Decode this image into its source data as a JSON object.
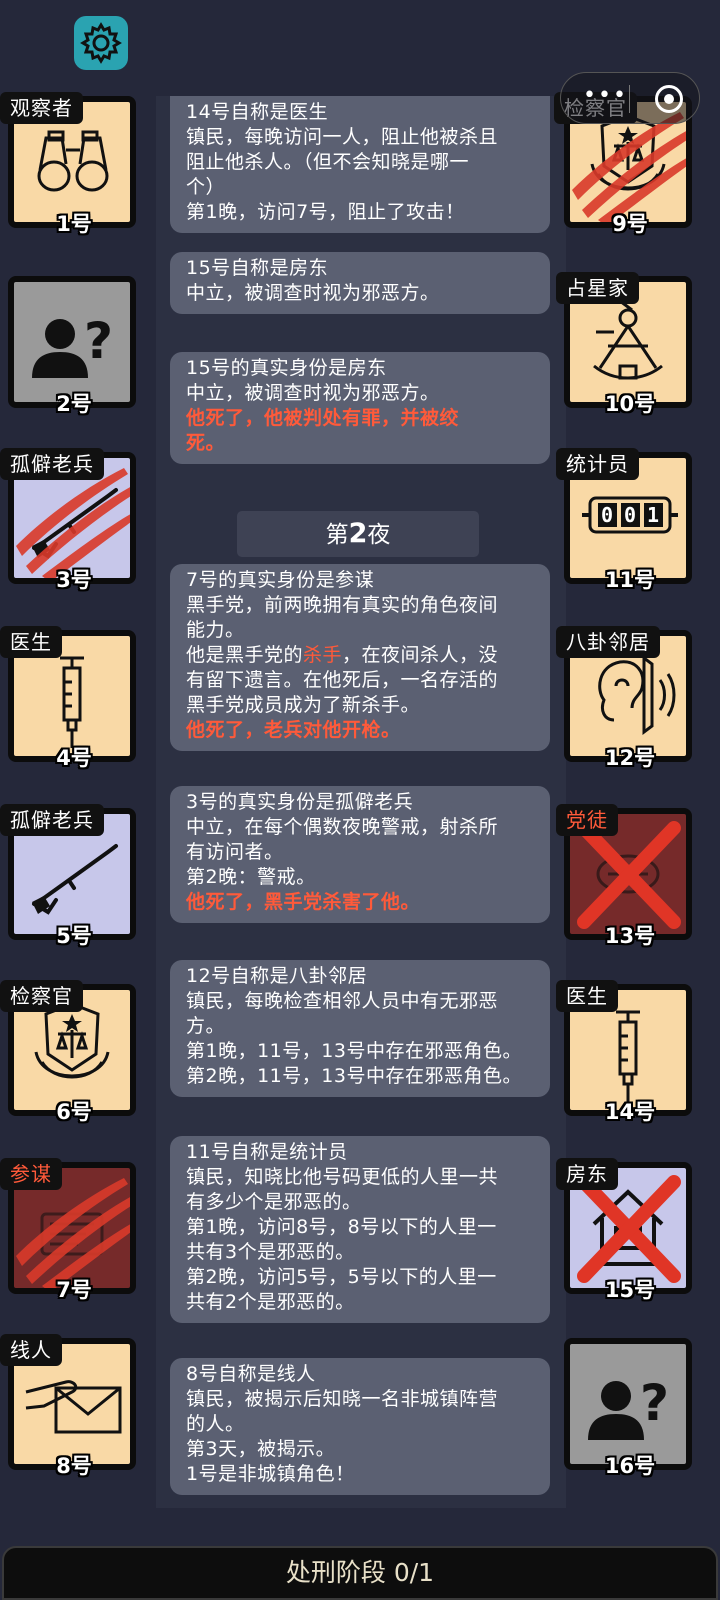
{
  "controls": {
    "settings_icon": "gear-icon",
    "menu_icon": "more-dots-icon",
    "close_icon": "target-icon",
    "menu_dots": "•••"
  },
  "players": [
    {
      "num": "1号",
      "role": "观察者",
      "icon": "binoculars-icon",
      "state": "alive"
    },
    {
      "num": "2号",
      "role": "",
      "icon": "unknown-person-icon",
      "state": "unknown"
    },
    {
      "num": "3号",
      "role": "孤僻老兵",
      "icon": "rifle-icon",
      "state": "clawed"
    },
    {
      "num": "4号",
      "role": "医生",
      "icon": "syringe-icon",
      "state": "alive"
    },
    {
      "num": "5号",
      "role": "孤僻老兵",
      "icon": "rifle-icon",
      "state": "alive"
    },
    {
      "num": "6号",
      "role": "检察官",
      "icon": "prosecutor-badge-icon",
      "state": "alive"
    },
    {
      "num": "7号",
      "role": "参谋",
      "icon": "planner-icon",
      "state": "clawed"
    },
    {
      "num": "8号",
      "role": "线人",
      "icon": "letter-hand-icon",
      "state": "alive"
    },
    {
      "num": "9号",
      "role": "检察官",
      "icon": "prosecutor-badge-icon",
      "state": "clawed"
    },
    {
      "num": "10号",
      "role": "占星家",
      "icon": "sextant-icon",
      "state": "alive"
    },
    {
      "num": "11号",
      "role": "统计员",
      "icon": "counter-icon",
      "state": "alive"
    },
    {
      "num": "12号",
      "role": "八卦邻居",
      "icon": "ear-icon",
      "state": "alive"
    },
    {
      "num": "13号",
      "role": "党徒",
      "icon": "cultist-icon",
      "state": "crossed"
    },
    {
      "num": "14号",
      "role": "医生",
      "icon": "syringe-icon",
      "state": "alive"
    },
    {
      "num": "15号",
      "role": "房东",
      "icon": "house-icon",
      "state": "crossed"
    },
    {
      "num": "16号",
      "role": "",
      "icon": "unknown-person-icon",
      "state": "unknown"
    }
  ],
  "counter_digits": "001",
  "log": {
    "night_banner_prefix": "第",
    "night_banner_num": "2",
    "night_banner_suffix": "夜",
    "messages": [
      {
        "lines": [
          {
            "t": "14号自称是医生"
          },
          {
            "t": "镇民，每晚访问一人，阻止他被杀且"
          },
          {
            "t": "阻止他杀人。（但不会知晓是哪一"
          },
          {
            "t": "个）"
          },
          {
            "t": "第1晚，访问7号，阻止了攻击！"
          }
        ]
      },
      {
        "lines": [
          {
            "t": "15号自称是房东"
          },
          {
            "t": "中立，被调查时视为邪恶方。"
          }
        ]
      },
      {
        "lines": [
          {
            "t": "15号的真实身份是房东"
          },
          {
            "t": "中立，被调查时视为邪恶方。"
          },
          {
            "t": "他死了，他被判处有罪，并被绞",
            "red": true
          },
          {
            "t": "死。",
            "red": true
          }
        ]
      },
      {
        "lines": [
          {
            "t": "7号的真实身份是参谋"
          },
          {
            "t": "黑手党，前两晚拥有真实的角色夜间"
          },
          {
            "t": "能力。"
          },
          {
            "t": "他是黑手党的",
            "hl": "杀手",
            "after": "，在夜间杀人，没"
          },
          {
            "t": "有留下遗言。在他死后，一名存活的"
          },
          {
            "t": "黑手党成员成为了新杀手。"
          },
          {
            "t": "他死了，老兵对他开枪。",
            "red": true
          }
        ]
      },
      {
        "lines": [
          {
            "t": "3号的真实身份是孤僻老兵"
          },
          {
            "t": "中立，在每个偶数夜晚警戒，射杀所"
          },
          {
            "t": "有访问者。"
          },
          {
            "t": "第2晚：警戒。"
          },
          {
            "t": "他死了，黑手党杀害了他。",
            "red": true
          }
        ]
      },
      {
        "lines": [
          {
            "t": "12号自称是八卦邻居"
          },
          {
            "t": "镇民，每晚检查相邻人员中有无邪恶"
          },
          {
            "t": "方。"
          },
          {
            "t": "第1晚，11号，13号中存在邪恶角色。"
          },
          {
            "t": "第2晚，11号，13号中存在邪恶角色。"
          }
        ]
      },
      {
        "lines": [
          {
            "t": "11号自称是统计员"
          },
          {
            "t": "镇民，知晓比他号码更低的人里一共"
          },
          {
            "t": "有多少个是邪恶的。"
          },
          {
            "t": "第1晚，访问8号，8号以下的人里一"
          },
          {
            "t": "共有3个是邪恶的。"
          },
          {
            "t": "第2晚，访问5号，5号以下的人里一"
          },
          {
            "t": "共有2个是邪恶的。"
          }
        ]
      },
      {
        "lines": [
          {
            "t": "8号自称是线人"
          },
          {
            "t": "镇民，被揭示后知晓一名非城镇阵营"
          },
          {
            "t": "的人。"
          },
          {
            "t": "第3天，被揭示。"
          },
          {
            "t": "1号是非城镇角色！"
          }
        ]
      }
    ]
  },
  "phase": {
    "label": "处刑阶段 0/1"
  },
  "colors": {
    "background": "#25283a",
    "bubble": "#5b6072",
    "death_text": "#ff5a3a",
    "card_beige": "#f9d9a6",
    "card_gray": "#9a9a9a",
    "card_lavender": "#c7c7ea",
    "card_darkred": "#762a2a",
    "settings_teal": "#2aa3b1"
  }
}
